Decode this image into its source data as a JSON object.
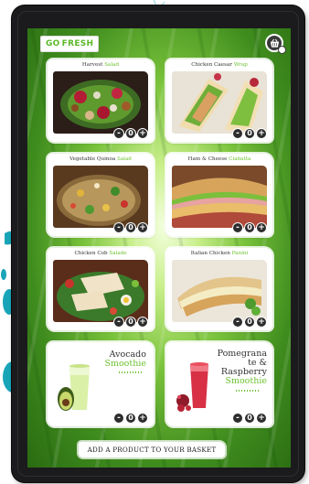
{
  "brand": {
    "logo_text_go": "GO",
    "logo_text_fresh": "FRESH"
  },
  "header": {
    "basket_icon": "basket-icon"
  },
  "products": [
    {
      "name": "Harvest ",
      "accent": "Salad",
      "qty": "0"
    },
    {
      "name": "Chicken Caesar ",
      "accent": "Wrap",
      "qty": "0"
    },
    {
      "name": "Vegetable Quinoa ",
      "accent": "Salad",
      "qty": "0"
    },
    {
      "name": "Ham & Cheese ",
      "accent": "Ciabatta",
      "qty": "0"
    },
    {
      "name": "Chicken Cob ",
      "accent": "Salade",
      "qty": "0"
    },
    {
      "name": "Italian Chicken ",
      "accent": "Panini",
      "qty": "0"
    },
    {
      "name": "Avocado",
      "accent": "Smoothie",
      "qty": "0"
    },
    {
      "name": "Pomegrana te & Raspberry",
      "accent": "Smoothie",
      "qty": "0"
    }
  ],
  "controls": {
    "minus": "-",
    "plus": "+"
  },
  "footer": {
    "cta_label": "ADD A PRODUCT TO YOUR BASKET"
  },
  "colors": {
    "accent": "#6cc230",
    "bezel": "#1b1b1d",
    "control": "#2d2d2d"
  }
}
